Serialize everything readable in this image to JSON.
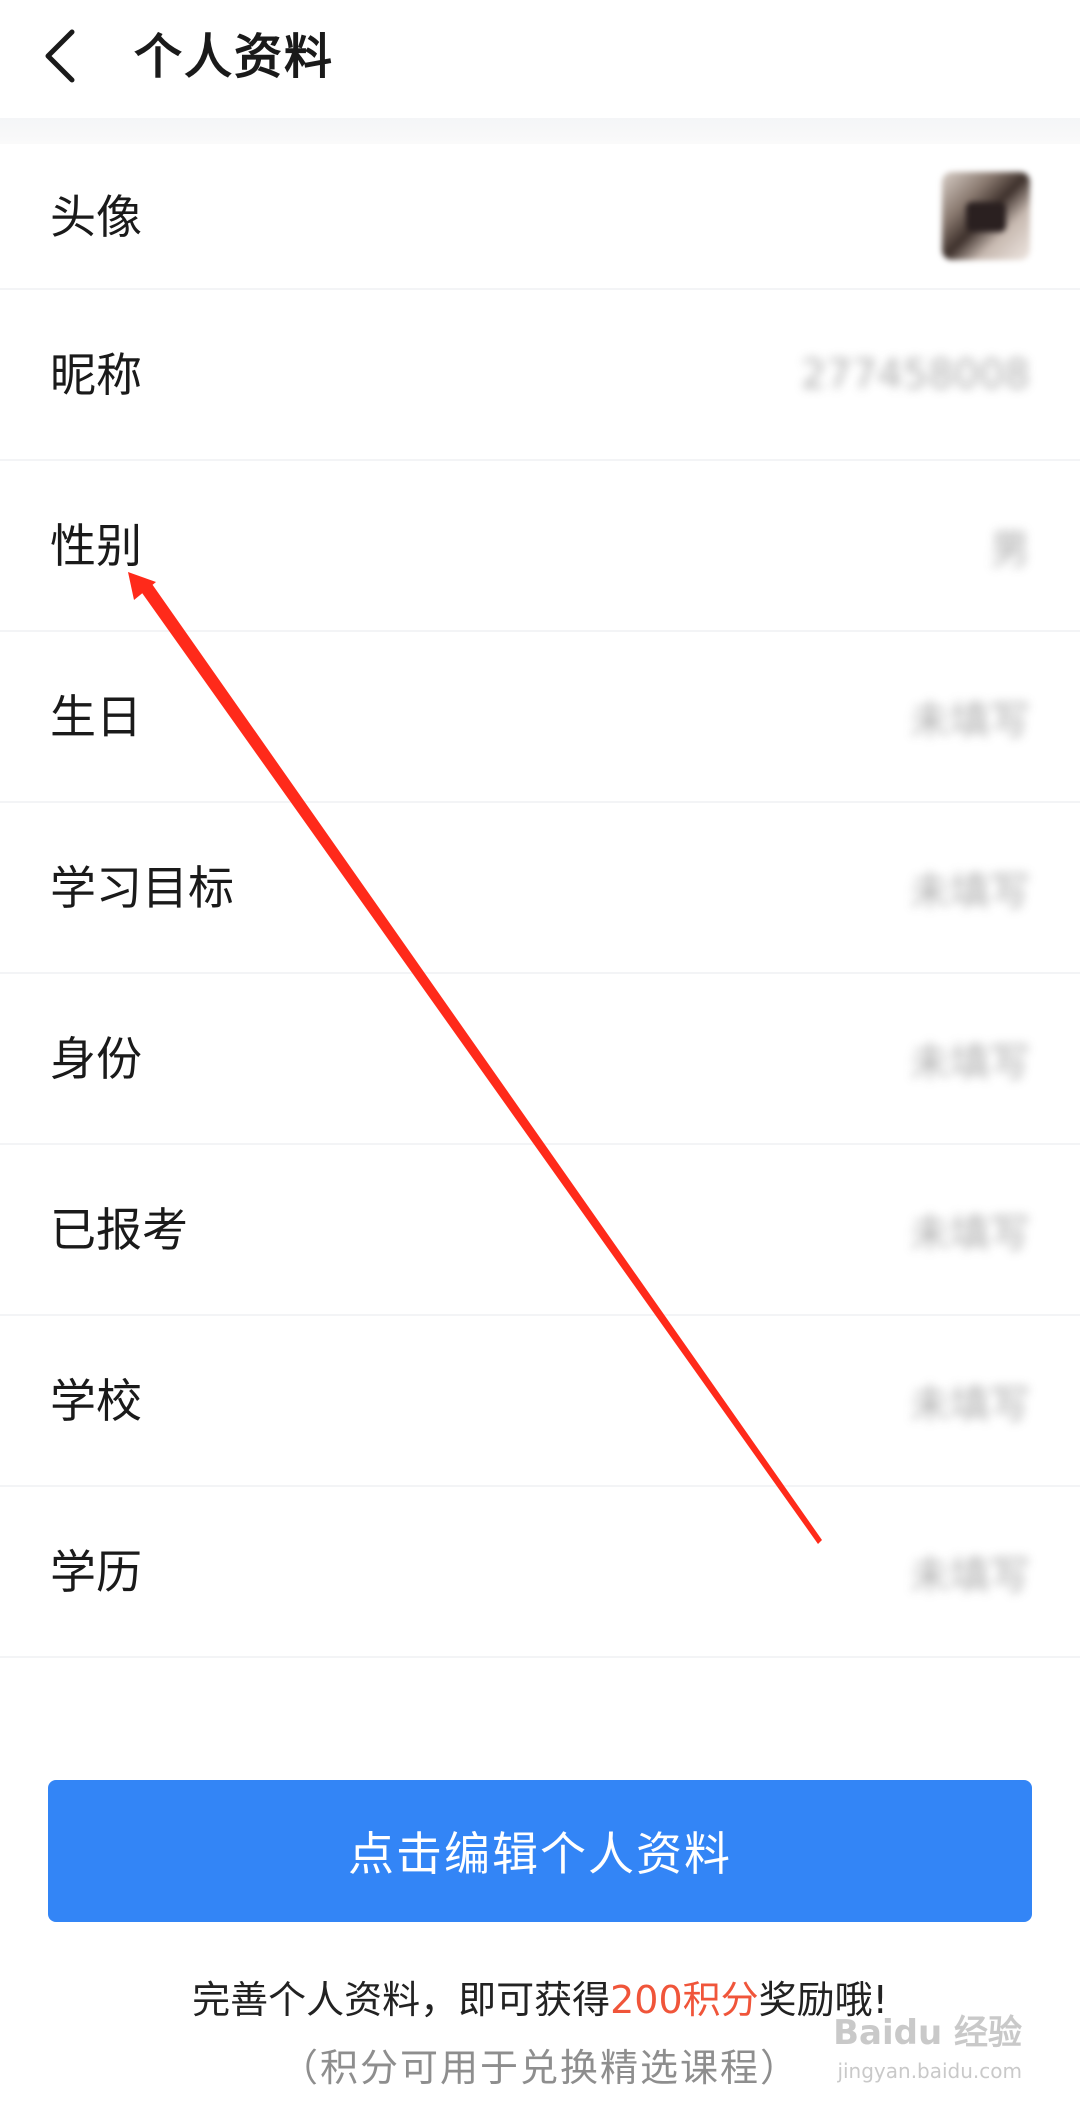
{
  "header": {
    "title": "个人资料",
    "back_icon": "chevron-left-icon"
  },
  "profile_rows": [
    {
      "label": "头像",
      "value": ""
    },
    {
      "label": "昵称",
      "value": "277458008"
    },
    {
      "label": "性别",
      "value": "男"
    },
    {
      "label": "生日",
      "value": "未填写"
    },
    {
      "label": "学习目标",
      "value": "未填写"
    },
    {
      "label": "身份",
      "value": "未填写"
    },
    {
      "label": "已报考",
      "value": "未填写"
    },
    {
      "label": "学校",
      "value": "未填写"
    },
    {
      "label": "学历",
      "value": "未填写"
    }
  ],
  "edit_button": {
    "label": "点击编辑个人资料"
  },
  "reward": {
    "prefix": "完善个人资料，即可获得",
    "highlight": "200积分",
    "suffix": "奖励哦!"
  },
  "note": "（积分可用于兑换精选课程）",
  "watermark": {
    "brand": "Baidu 经验",
    "url": "jingyan.baidu.com"
  },
  "colors": {
    "accent": "#3385f6",
    "highlight": "#f0553a",
    "annotation_arrow": "#ff2a1a"
  }
}
